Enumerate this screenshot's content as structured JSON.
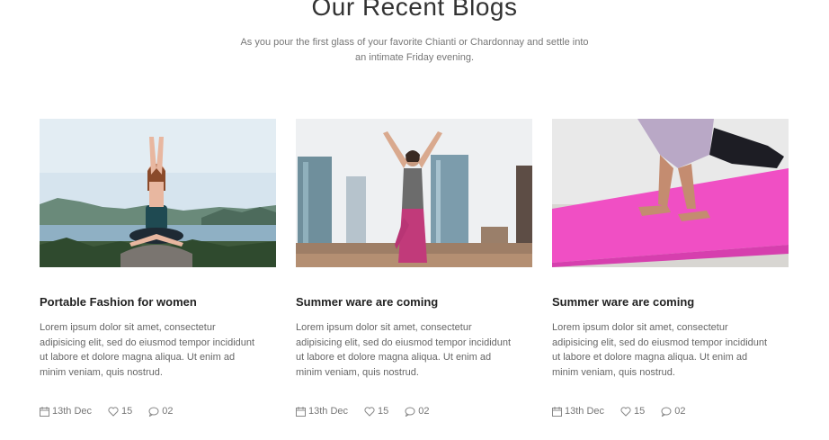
{
  "section": {
    "title": "Our Recent Blogs",
    "subtitle_line1": "As you pour the first glass of your favorite Chianti or Chardonnay and settle into",
    "subtitle_line2": "an intimate Friday evening."
  },
  "posts": [
    {
      "title": "Portable Fashion for women",
      "desc": "Lorem ipsum dolor sit amet, consectetur adipisicing elit, sed do eiusmod tempor incididunt ut labore et dolore magna aliqua. Ut enim ad minim veniam, quis nostrud.",
      "date": "13th Dec",
      "likes": "15",
      "comments": "02",
      "image": "woman-yoga-lake-photo"
    },
    {
      "title": "Summer ware are coming",
      "desc": "Lorem ipsum dolor sit amet, consectetur adipisicing elit, sed do eiusmod tempor incididunt ut labore et dolore magna aliqua. Ut enim ad minim veniam, quis nostrud.",
      "date": "13th Dec",
      "likes": "15",
      "comments": "02",
      "image": "woman-yoga-city-photo"
    },
    {
      "title": "Summer ware are coming",
      "desc": "Lorem ipsum dolor sit amet, consectetur adipisicing elit, sed do eiusmod tempor incididunt ut labore et dolore magna aliqua. Ut enim ad minim veniam, quis nostrud.",
      "date": "13th Dec",
      "likes": "15",
      "comments": "02",
      "image": "woman-pushup-mat-photo"
    }
  ],
  "icons": {
    "date": "calendar-icon",
    "likes": "heart-icon",
    "comments": "comment-icon"
  },
  "colors": {
    "mat_pink": "#f04fc4",
    "text_muted": "#777777"
  }
}
